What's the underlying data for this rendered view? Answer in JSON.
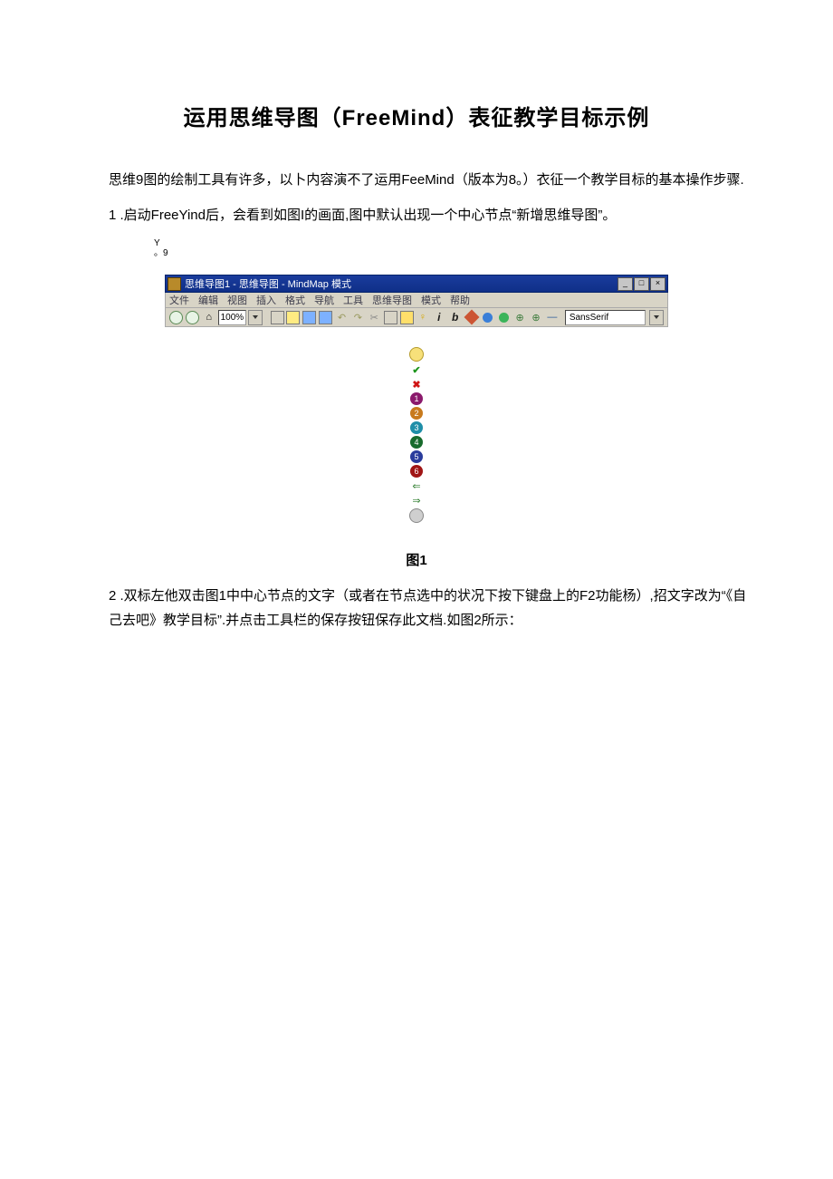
{
  "doc": {
    "title": "运用思维导图（FreeMind）表征教学目标示例",
    "intro": "思维9图的绘制工具有许多，以卜内容演不了运用FeeMind（版本为8。）衣征一个教学目标的基本操作步骤.",
    "step1": "1 .启动FreeYind后，会看到如图I的画面,图中默认出现一个中心节点“新增思维导图”。",
    "small1": "Y",
    "small2": "。9",
    "caption1": "图1",
    "step2": "2 .双标左他双击图1中中心节点的文字（或者在节点选中的状况下按下键盘上的F2功能杨）,招文字改为“《自己去吧》教学目标”.并点击工具栏的保存按钮保存此文档.如图2所示："
  },
  "shot": {
    "titlebar": "思维导图1 - 思维导图 - MindMap 模式",
    "menu": [
      "文件",
      "编辑",
      "视图",
      "插入",
      "格式",
      "导航",
      "工具",
      "思维导图",
      "模式",
      "帮助"
    ],
    "zoom": "100%",
    "font": "SansSerif",
    "strip_labels": [
      "1",
      "2",
      "3",
      "4",
      "5",
      "6"
    ]
  }
}
